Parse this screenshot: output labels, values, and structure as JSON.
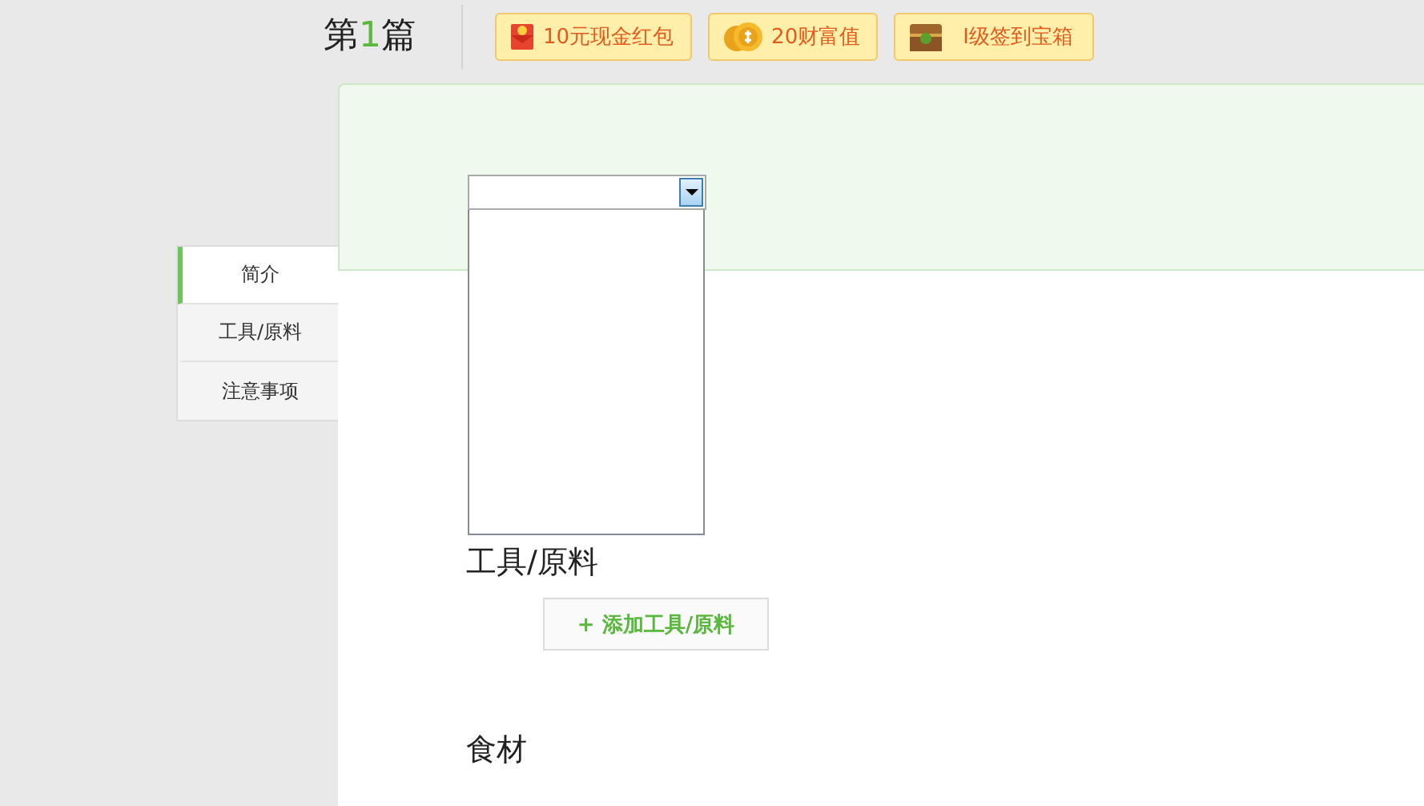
{
  "header": {
    "title": {
      "before": "第",
      "number": "1",
      "after": "篇"
    },
    "badges": [
      {
        "kind": "envelope",
        "label": "10元现金红包"
      },
      {
        "kind": "coins",
        "label": "20财富值"
      },
      {
        "kind": "chest",
        "label": "I级签到宝箱"
      }
    ]
  },
  "tabs": [
    {
      "label": "简介",
      "selected": true
    },
    {
      "label": "工具/原料",
      "selected": false
    },
    {
      "label": "注意事项",
      "selected": false
    }
  ],
  "dropdown": {
    "expanded": true
  },
  "sections": [
    {
      "heading": "工具/原料",
      "button": "+ 添加工具/原料"
    },
    {
      "heading": "食材"
    }
  ]
}
